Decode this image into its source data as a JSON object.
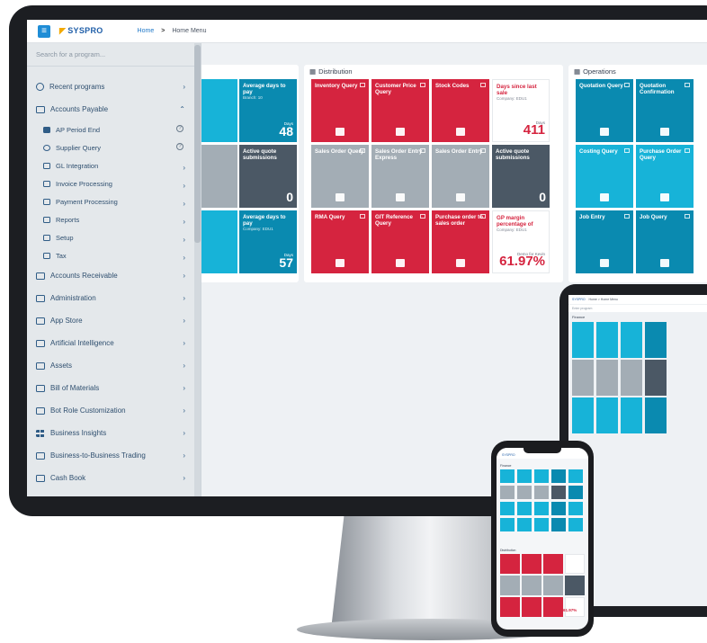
{
  "topbar": {
    "brand": "SYSPRO",
    "breadcrumb_home": "Home",
    "breadcrumb_sep": ">",
    "breadcrumb_current": "Home Menu"
  },
  "sidebar": {
    "search_placeholder": "Search for a program...",
    "items": [
      {
        "label": "Recent programs",
        "icon": "clock-icon",
        "chev": ">"
      },
      {
        "label": "Accounts Payable",
        "icon": "folder-icon",
        "chev": "^"
      },
      {
        "label": "AP Period End",
        "icon": "program-icon",
        "help": "?"
      },
      {
        "label": "Supplier Query",
        "icon": "clock-icon",
        "help": "?"
      },
      {
        "label": "GL Integration",
        "icon": "folder-icon",
        "chev": ">"
      },
      {
        "label": "Invoice Processing",
        "icon": "folder-icon",
        "chev": ">"
      },
      {
        "label": "Payment Processing",
        "icon": "folder-icon",
        "chev": ">"
      },
      {
        "label": "Reports",
        "icon": "folder-icon",
        "chev": ">"
      },
      {
        "label": "Setup",
        "icon": "folder-icon",
        "chev": ">"
      },
      {
        "label": "Tax",
        "icon": "folder-icon",
        "chev": ">"
      },
      {
        "label": "Accounts Receivable",
        "icon": "folder-icon",
        "chev": ">"
      },
      {
        "label": "Administration",
        "icon": "folder-icon",
        "chev": ">"
      },
      {
        "label": "App Store",
        "icon": "folder-icon",
        "chev": ">"
      },
      {
        "label": "Artificial Intelligence",
        "icon": "folder-icon",
        "chev": ">"
      },
      {
        "label": "Assets",
        "icon": "folder-icon",
        "chev": ">"
      },
      {
        "label": "Bill of Materials",
        "icon": "folder-icon",
        "chev": ">"
      },
      {
        "label": "Bot Role Customization",
        "icon": "folder-icon",
        "chev": ">"
      },
      {
        "label": "Business Insights",
        "icon": "grid-icon",
        "chev": ">"
      },
      {
        "label": "Business-to-Business Trading",
        "icon": "folder-icon",
        "chev": ">"
      },
      {
        "label": "Cash Book",
        "icon": "folder-icon",
        "chev": ">"
      }
    ]
  },
  "finance_partial": {
    "tiles": [
      {
        "title": "y",
        "color": "#17b3d8"
      },
      {
        "title": "Average days to pay",
        "sub": "Branch: 10",
        "label": "Days",
        "value": "48",
        "color": "#0a8ab0"
      },
      {
        "title": "tock",
        "color": "#a3adb5"
      },
      {
        "title": "Active quote submissions",
        "value": "0",
        "color": "#4b5865"
      },
      {
        "title": "",
        "color": "#17b3d8"
      },
      {
        "title": "Average days to pay",
        "sub": "Company: EDU1",
        "label": "Days",
        "value": "57",
        "color": "#0a8ab0"
      }
    ]
  },
  "distribution": {
    "title": "Distribution",
    "tiles": [
      {
        "title": "Inventory Query",
        "color": "#d5243f",
        "icon": "grid-plus-icon"
      },
      {
        "title": "Customer Price Query",
        "color": "#d5243f",
        "icon": "tag-icon"
      },
      {
        "title": "Stock Codes",
        "color": "#d5243f",
        "icon": "card-icon"
      },
      {
        "title": "Days since last sale",
        "sub": "Company: EDU1",
        "label": "Days",
        "value": "411",
        "color": "#ffffff"
      },
      {
        "title": "Sales Order Query",
        "color": "#a3adb5",
        "icon": "cart-icon"
      },
      {
        "title": "Sales Order Entry Express",
        "color": "#a3adb5",
        "icon": "window-icon"
      },
      {
        "title": "Sales Order Entry",
        "color": "#a3adb5",
        "icon": "cart-add-icon"
      },
      {
        "title": "Active quote submissions",
        "value": "0",
        "color": "#4b5865"
      },
      {
        "title": "RMA Query",
        "color": "#d5243f",
        "icon": "clipboard-icon"
      },
      {
        "title": "GIT Reference Query",
        "color": "#d5243f",
        "icon": "train-icon"
      },
      {
        "title": "Purchase order to sales order",
        "color": "#d5243f",
        "icon": "eye-icon"
      },
      {
        "title": "GP margin percentage of",
        "sub": "Company: EDU1",
        "label": "Demo for Kevin",
        "value": "61.97%",
        "color": "#ffffff"
      }
    ]
  },
  "operations": {
    "title": "Operations",
    "tiles": [
      {
        "title": "Quotation Query",
        "color": "#0a8ab0",
        "icon": "question-icon"
      },
      {
        "title": "Quotation Confirmation",
        "color": "#0a8ab0",
        "icon": "pin-icon"
      },
      {
        "title": "Costing Query",
        "color": "#17b3d8",
        "icon": "tag-icon"
      },
      {
        "title": "Purchase Order Query",
        "color": "#17b3d8",
        "icon": "cart-icon"
      },
      {
        "title": "Job Entry",
        "color": "#0a8ab0",
        "icon": "list-icon"
      },
      {
        "title": "Job Query",
        "color": "#0a8ab0",
        "icon": "image-icon"
      }
    ]
  },
  "tablet": {
    "brand": "SYSPRO",
    "breadcrumb": "Home > Home Menu",
    "search": "Enter program",
    "section": "Finance"
  },
  "phone": {
    "brand": "SYSPRO",
    "section1": "Finance",
    "section2": "Distribution",
    "kpi": "61.97%"
  }
}
